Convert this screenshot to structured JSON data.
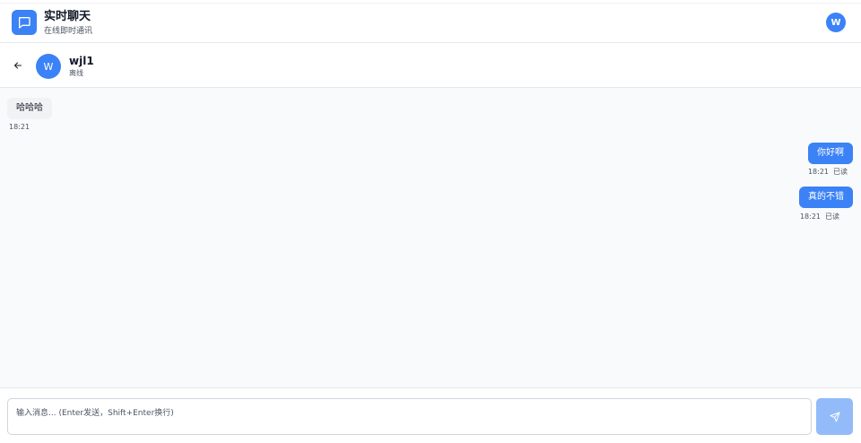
{
  "app": {
    "title": "实时聊天",
    "subtitle": "在线即时通讯",
    "logo_icon": "chat-bubble-icon",
    "user_avatar_initial": "W",
    "accent_color": "#3b82f6"
  },
  "chat_header": {
    "back_icon": "arrow-left-icon",
    "contact_initial": "W",
    "contact_name": "wjl1",
    "contact_status": "离线"
  },
  "messages": [
    {
      "direction": "incoming",
      "text": "哈哈哈",
      "time": "18:21",
      "read": ""
    },
    {
      "direction": "outgoing",
      "text": "你好啊",
      "time": "18:21",
      "read": "已读"
    },
    {
      "direction": "outgoing",
      "text": "真的不错",
      "time": "18:21",
      "read": "已读"
    }
  ],
  "composer": {
    "placeholder": "输入消息... (Enter发送，Shift+Enter换行)",
    "value": "",
    "send_icon": "send-icon",
    "send_button_color": "#93bbf9"
  }
}
